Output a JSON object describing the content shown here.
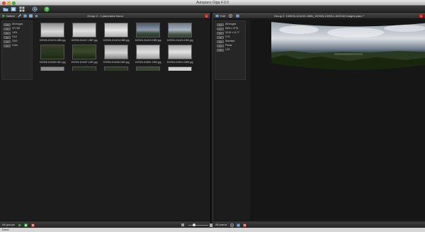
{
  "window": {
    "title": "Autopano Giga 4.0.0"
  },
  "toolbar": {
    "icons": [
      "folder-icon",
      "import-icon",
      "grid-view-icon",
      "settings-gear-icon",
      "help-icon"
    ]
  },
  "left_pane": {
    "header": {
      "detect_label": "Detect",
      "group_title": "Group 2 - 1 panorama found"
    },
    "info": [
      "88 images",
      "377.9M",
      "1024",
      "F/18",
      "2019",
      "0.0ev"
    ],
    "info_tags": [
      "img",
      "mp",
      "iso",
      "ap",
      "sd",
      "ev"
    ],
    "images": [
      {
        "name": "100926-104415-1586.jpg",
        "style": "sky"
      },
      {
        "name": "100926-104417-1587.jpg",
        "style": "sky"
      },
      {
        "name": "100926-104418-1588.jpg",
        "style": "sky"
      },
      {
        "name": "100926-104419-1589.jpg",
        "style": "landscape"
      },
      {
        "name": "100926-104420-1590.jpg",
        "style": "landscape"
      },
      {
        "name": "100926-104455-1591.jpg",
        "style": "dark-trees"
      },
      {
        "name": "100926-104457-1592.jpg",
        "style": "dark-trees"
      },
      {
        "name": "100926-104458-1593.jpg",
        "style": "sky"
      },
      {
        "name": "100926-104501-1594.jpg",
        "style": "sky"
      },
      {
        "name": "100926-104510-1595.jpg",
        "style": "sky"
      }
    ],
    "footer": {
      "label": "All groups"
    }
  },
  "right_pane": {
    "header": {
      "edit_label": "Edit",
      "title": "Group 2: 100926-104415-1586_100926-104511-1603 88 images.pano *"
    },
    "info": [
      "88 images",
      "8000 x 3776",
      "30.00 x 14.77",
      "3.76",
      "Standard",
      "Planar",
      "LDR"
    ],
    "info_tags": [
      "img",
      "px",
      "fov",
      "mp",
      "alg",
      "prj",
      "ldr"
    ],
    "footer": {
      "label": "All panos"
    }
  },
  "status": {
    "text": "Done"
  },
  "colors": {
    "close_red": "#c92a1f",
    "play_green": "#3cbb3c",
    "help_green": "#45b649"
  }
}
